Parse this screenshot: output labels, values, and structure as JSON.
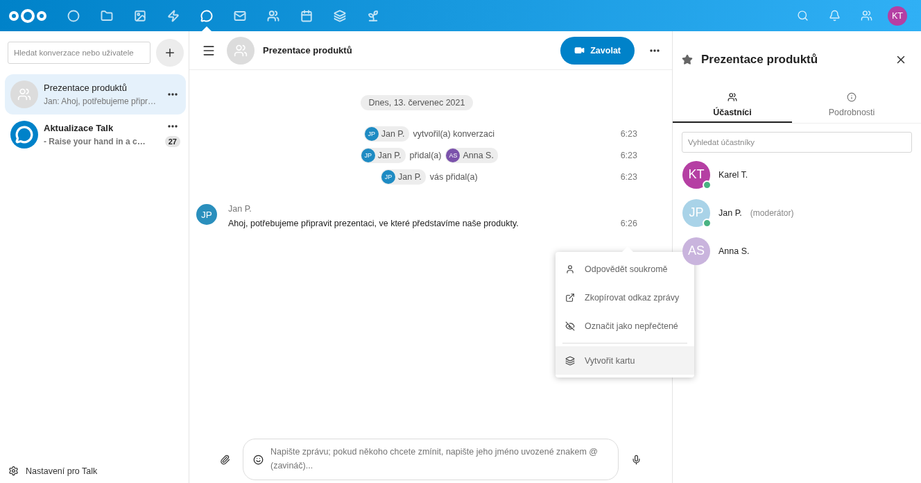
{
  "header": {
    "apps": [
      {
        "selected": false
      },
      {
        "selected": false
      },
      {
        "selected": false
      },
      {
        "selected": false
      },
      {
        "selected": true
      },
      {
        "selected": false
      },
      {
        "selected": false
      },
      {
        "selected": false
      },
      {
        "selected": false
      },
      {
        "selected": false
      }
    ],
    "user": {
      "initials": "KT",
      "color": "#b53fa3"
    }
  },
  "sidebar": {
    "search": {
      "placeholder": "Hledat konverzace nebo uživatele"
    },
    "conversations": [
      {
        "kind": "group",
        "name": "Prezentace produktů",
        "preview": "Jan: Ahoj, potřebujeme připr…",
        "selected": true,
        "unread": false
      },
      {
        "kind": "talk",
        "name": "Aktualizace Talk",
        "preview": "- Raise your hand in a c…",
        "selected": false,
        "unread": true,
        "count": "27"
      }
    ],
    "settings": "Nastavení pro Talk"
  },
  "chat": {
    "title": "Prezentace produktů",
    "call_button": "Zavolat",
    "date": "Dnes, 13. červenec 2021",
    "system_messages": [
      {
        "parts": [
          {
            "kind": "mention",
            "initials": "JP",
            "name": "Jan P.",
            "color": "#1e8bc3"
          },
          {
            "kind": "text",
            "text": "vytvořil(a) konverzaci"
          }
        ],
        "time": "6:23"
      },
      {
        "parts": [
          {
            "kind": "mention",
            "initials": "JP",
            "name": "Jan P.",
            "color": "#1e8bc3"
          },
          {
            "kind": "text",
            "text": "přidal(a)"
          },
          {
            "kind": "mention",
            "initials": "AS",
            "name": "Anna S.",
            "color": "#7b52ab"
          }
        ],
        "time": "6:23"
      },
      {
        "parts": [
          {
            "kind": "mention",
            "initials": "JP",
            "name": "Jan P.",
            "color": "#1e8bc3"
          },
          {
            "kind": "text",
            "text": "vás přidal(a)"
          }
        ],
        "time": "6:23"
      }
    ],
    "messages": [
      {
        "initials": "JP",
        "author": "Jan P.",
        "text": "Ahoj, potřebujeme připravit prezentaci, ve které představíme naše produkty.",
        "time": "6:26",
        "color": "#2a8fbd"
      }
    ],
    "menu": [
      {
        "kind": "item",
        "label": "Odpovědět soukromě",
        "highlighted": false
      },
      {
        "kind": "item",
        "label": "Zkopírovat odkaz zprávy",
        "highlighted": false
      },
      {
        "kind": "item",
        "label": "Označit jako nepřečtené",
        "highlighted": false
      },
      {
        "kind": "separator"
      },
      {
        "kind": "item",
        "label": "Vytvořit kartu",
        "highlighted": true
      }
    ],
    "composer": {
      "placeholder": "Napište zprávu; pokud někoho chcete zmínit, napište jeho jméno uvozené znakem @ (zavináč)..."
    }
  },
  "panel": {
    "title": "Prezentace produktů",
    "tabs": [
      {
        "label": "Účastníci",
        "selected": true
      },
      {
        "label": "Podrobnosti",
        "selected": false
      }
    ],
    "search": {
      "placeholder": "Vyhledat účastníky"
    },
    "participants": [
      {
        "initials": "KT",
        "name": "Karel T.",
        "color": "#b53fa3",
        "online": true
      },
      {
        "initials": "JP",
        "name": "Jan P.",
        "role": "(moderátor)",
        "color": "#a9d3e8",
        "online": true
      },
      {
        "initials": "AS",
        "name": "Anna S.",
        "color": "#c9b4dd",
        "online": false
      }
    ]
  }
}
